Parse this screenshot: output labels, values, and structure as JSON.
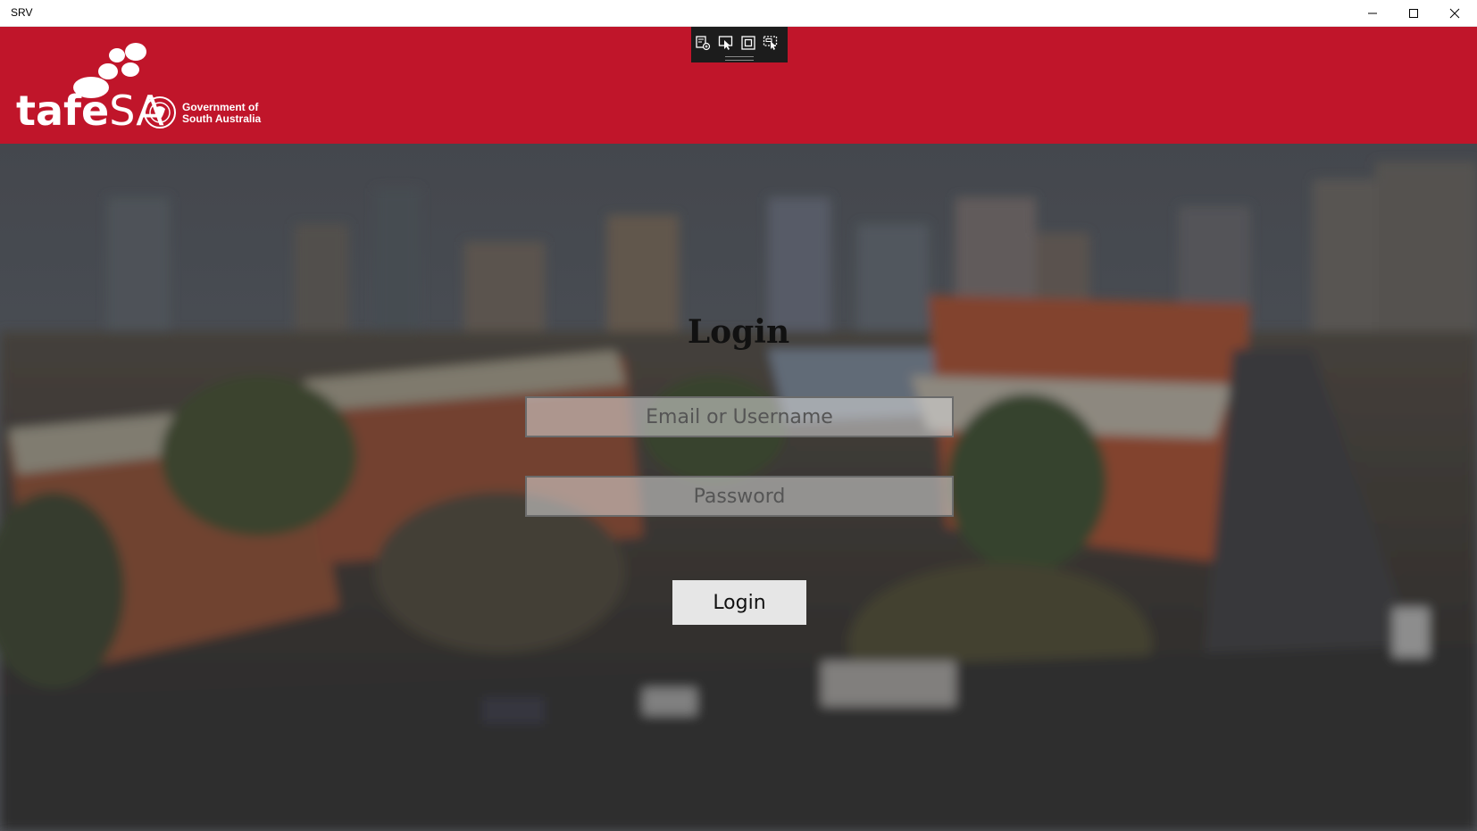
{
  "window": {
    "title": "SRV",
    "minimize_icon": "minimize-icon",
    "maximize_icon": "maximize-icon",
    "close_icon": "close-icon"
  },
  "header": {
    "brand_name_part1": "tafe",
    "brand_name_part2": "SA",
    "government_line1": "Government of",
    "government_line2": "South Australia",
    "background_color": "#c0152a"
  },
  "debug_toolbar": {
    "icons": [
      "live-tree-icon",
      "select-element-icon",
      "display-layout-adorners-icon",
      "track-focus-icon"
    ]
  },
  "login": {
    "title": "Login",
    "email_placeholder": "Email or Username",
    "password_placeholder": "Password",
    "submit_label": "Login"
  }
}
